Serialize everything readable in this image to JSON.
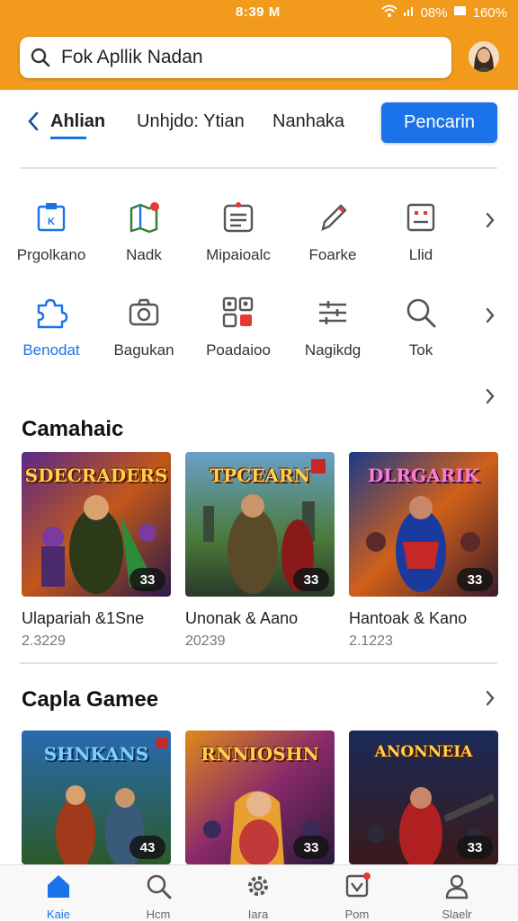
{
  "status": {
    "time": "8:39 M",
    "battery": "08%",
    "signal_text": "160%"
  },
  "search": {
    "text": "Fok Apllik Nadan"
  },
  "tabs": {
    "items": [
      {
        "label": "Ahlian",
        "active": true
      },
      {
        "label": "Unhjdo: Ytian",
        "active": false
      },
      {
        "label": "Nanhaka",
        "active": false
      }
    ],
    "cta_label": "Pencarin"
  },
  "categories": {
    "row1": [
      {
        "label": "Prgolkano",
        "icon": "calendar-icon"
      },
      {
        "label": "Nadk",
        "icon": "map-icon"
      },
      {
        "label": "Mipaioalc",
        "icon": "list-card-icon"
      },
      {
        "label": "Foarke",
        "icon": "pen-icon"
      },
      {
        "label": "Llid",
        "icon": "id-card-icon"
      }
    ],
    "row2": [
      {
        "label": "Benodat",
        "icon": "puzzle-icon"
      },
      {
        "label": "Bagukan",
        "icon": "camera-icon"
      },
      {
        "label": "Poadaioo",
        "icon": "grid-apps-icon"
      },
      {
        "label": "Nagikdg",
        "icon": "sliders-icon"
      },
      {
        "label": "Tok",
        "icon": "search-icon"
      }
    ]
  },
  "sections": [
    {
      "title": "Camahaic",
      "cards": [
        {
          "art_title": "SDECRADERS",
          "name": "Ulapariah &1Sne",
          "number": "2.3229",
          "badge": "33"
        },
        {
          "art_title": "TPCEARN",
          "name": "Unonak & Aano",
          "number": "20239",
          "badge": "33"
        },
        {
          "art_title": "DLRGARIK",
          "name": "Hantoak & Kano",
          "number": "2.1223",
          "badge": "33"
        }
      ]
    },
    {
      "title": "Capla Gamee",
      "cards": [
        {
          "art_title": "SHNKANS",
          "badge": "43"
        },
        {
          "art_title": "RNNIOSHN",
          "badge": "33"
        },
        {
          "art_title": "ANONNEIA",
          "badge": "33"
        }
      ]
    }
  ],
  "bottom_nav": [
    {
      "label": "Kaie",
      "icon": "home-icon",
      "active": true
    },
    {
      "label": "Hcm",
      "icon": "search-icon",
      "active": false
    },
    {
      "label": "Iara",
      "icon": "gear-icon",
      "active": false
    },
    {
      "label": "Pom",
      "icon": "shield-icon",
      "active": false
    },
    {
      "label": "Slaelr",
      "icon": "user-icon",
      "active": false
    }
  ],
  "colors": {
    "accent": "#1a73e8",
    "topbar": "#f29a1c"
  }
}
